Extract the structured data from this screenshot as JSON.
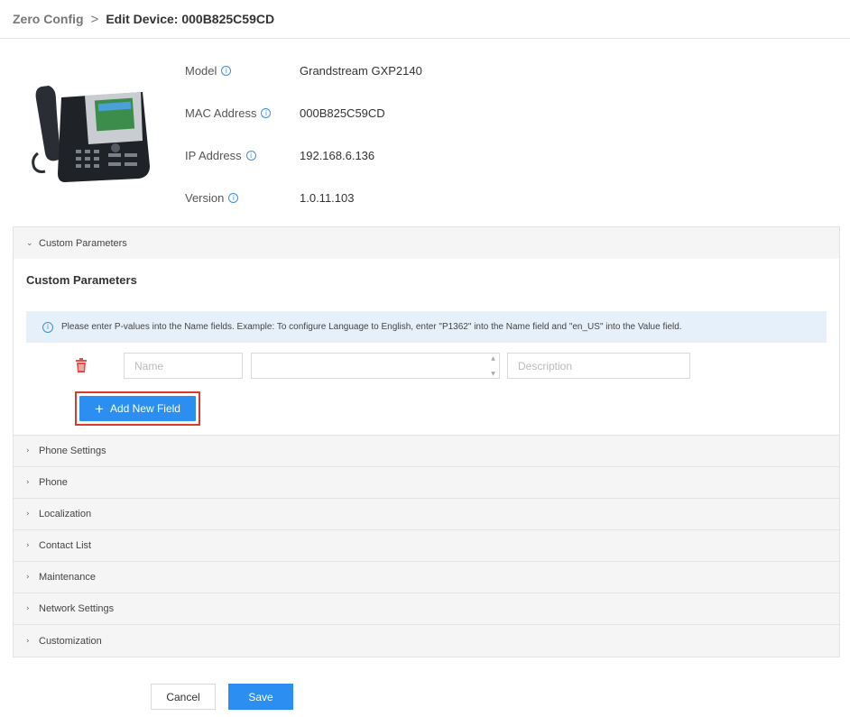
{
  "breadcrumb": {
    "parent": "Zero Config",
    "separator": ">",
    "current": "Edit Device: 000B825C59CD"
  },
  "device": {
    "rows": [
      {
        "label": "Model",
        "value": "Grandstream GXP2140"
      },
      {
        "label": "MAC Address",
        "value": "000B825C59CD"
      },
      {
        "label": "IP Address",
        "value": "192.168.6.136"
      },
      {
        "label": "Version",
        "value": "1.0.11.103"
      }
    ]
  },
  "custom_params": {
    "header": "Custom Parameters",
    "title": "Custom Parameters",
    "notice": "Please enter P-values into the Name fields. Example: To configure Language to English, enter \"P1362\" into the Name field and \"en_US\" into the Value field.",
    "name_placeholder": "Name",
    "value_placeholder": "",
    "desc_placeholder": "Description",
    "add_button": "Add New Field"
  },
  "sections": [
    "Phone Settings",
    "Phone",
    "Localization",
    "Contact List",
    "Maintenance",
    "Network Settings",
    "Customization"
  ],
  "actions": {
    "cancel": "Cancel",
    "save": "Save"
  },
  "icons": {
    "info": "info-icon",
    "delete": "trash-icon",
    "chevron_open": "chevron-down-icon",
    "chevron_closed": "chevron-right-icon",
    "plus": "plus-icon"
  },
  "colors": {
    "accent": "#2b8ef0",
    "highlight": "#d93a2b",
    "danger": "#e0504a",
    "notice_bg": "#e6f0fb"
  }
}
